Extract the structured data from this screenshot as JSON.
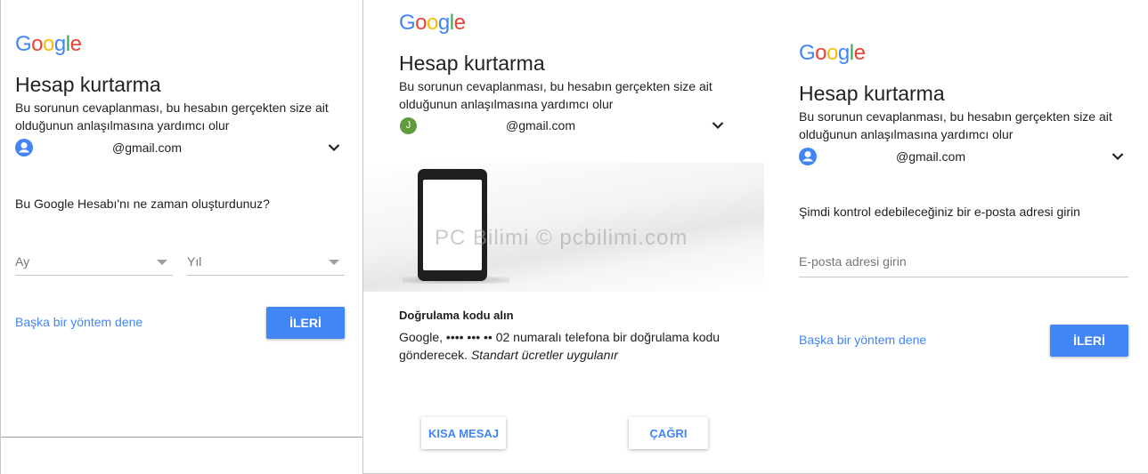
{
  "brand": {
    "logo_letters": [
      "G",
      "o",
      "o",
      "g",
      "l",
      "e"
    ],
    "colors": {
      "blue": "#4285f4",
      "red": "#ea4335",
      "yellow": "#fbbc05",
      "green": "#34a853"
    }
  },
  "panel1": {
    "title": "Hesap kurtarma",
    "subtitle_line1": "Bu sorunun cevaplanması, bu hesabın gerçekten size ait",
    "subtitle_line2": "olduğunun anlaşılmasına yardımcı olur",
    "account": "@gmail.com",
    "account_icon": "account-circle-icon",
    "question": "Bu Google Hesabı'nı ne zaman oluşturdunuz?",
    "month_placeholder": "Ay",
    "year_placeholder": "Yıl",
    "alt_link": "Başka bir yöntem dene",
    "next_button": "İLERİ"
  },
  "panel2": {
    "title": "Hesap kurtarma",
    "subtitle_line1": "Bu sorunun cevaplanması, bu hesabın gerçekten size ait",
    "subtitle_line2": "olduğunun anlaşılmasına yardımcı olur",
    "avatar_letter": "J",
    "account": "@gmail.com",
    "watermark": "PC Bilimi © pcbilimi.com",
    "code_title": "Doğrulama kodu alın",
    "code_text_line1": "Google, •••• ••• •• 02 numaralı telefona bir doğrulama kodu",
    "code_text_line2_plain": "gönderecek.",
    "code_text_line2_italic": "Standart ücretler uygulanır",
    "sms_button": "KISA MESAJ",
    "call_button": "ÇAĞRI"
  },
  "panel3": {
    "title": "Hesap kurtarma",
    "subtitle_line1": "Bu sorunun cevaplanması, bu hesabın gerçekten size ait",
    "subtitle_line2": "olduğunun anlaşılmasına yardımcı olur",
    "account": "@gmail.com",
    "account_icon": "account-circle-icon",
    "prompt": "Şimdi kontrol edebileceğiniz bir e-posta adresi girin",
    "email_placeholder": "E-posta adresi girin",
    "alt_link": "Başka bir yöntem dene",
    "next_button": "İLERİ"
  }
}
